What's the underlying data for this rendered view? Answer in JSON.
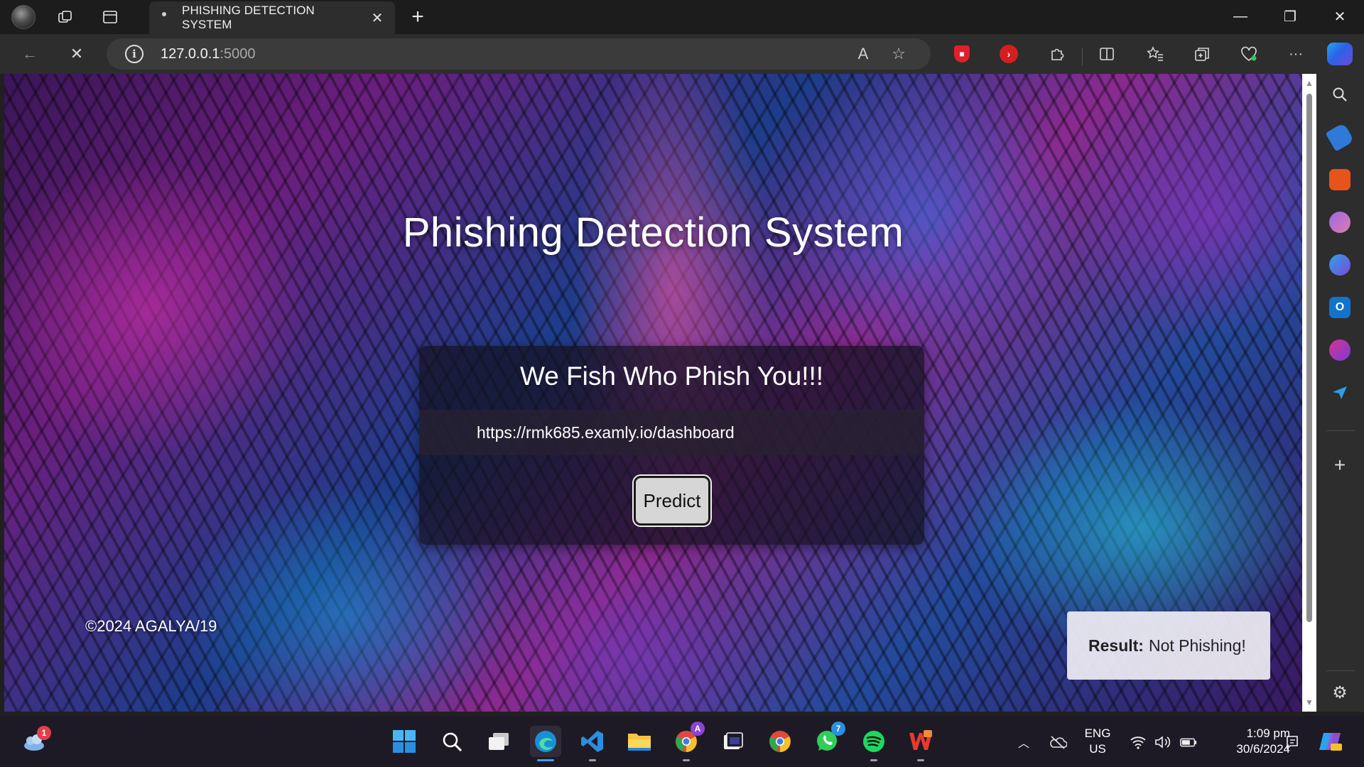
{
  "tab": {
    "title": "PHISHING DETECTION SYSTEM",
    "close_glyph": "✕"
  },
  "strip": {
    "new_tab_glyph": "+",
    "minimize_glyph": "—",
    "restore_glyph": "❐",
    "close_glyph": "✕"
  },
  "toolbar": {
    "back_glyph": "←",
    "stop_glyph": "✕",
    "url_host": "127.0.0.1",
    "url_port": ":5000",
    "read_aloud_glyph": "A",
    "favorite_glyph": "☆",
    "more_glyph": "···"
  },
  "page": {
    "title": "Phishing Detection System",
    "card_heading": "We Fish Who Phish You!!!",
    "url_value": "https://rmk685.examly.io/dashboard",
    "predict_label": "Predict",
    "footer": "©2024 AGALYA/19",
    "result_label": "Result:",
    "result_value": "Not Phishing!"
  },
  "sidebar": {
    "add_glyph": "+",
    "settings_glyph": "⚙"
  },
  "taskbar": {
    "notifications_badge": "1",
    "whatsapp_badge": "7",
    "lang_primary": "ENG",
    "lang_secondary": "US",
    "time": "1:09 pm",
    "date": "30/6/2024"
  },
  "colors": {
    "accent_edge": "#2b7fd8",
    "result_bg": "#f0eef4",
    "card_bg": "#14101e"
  }
}
